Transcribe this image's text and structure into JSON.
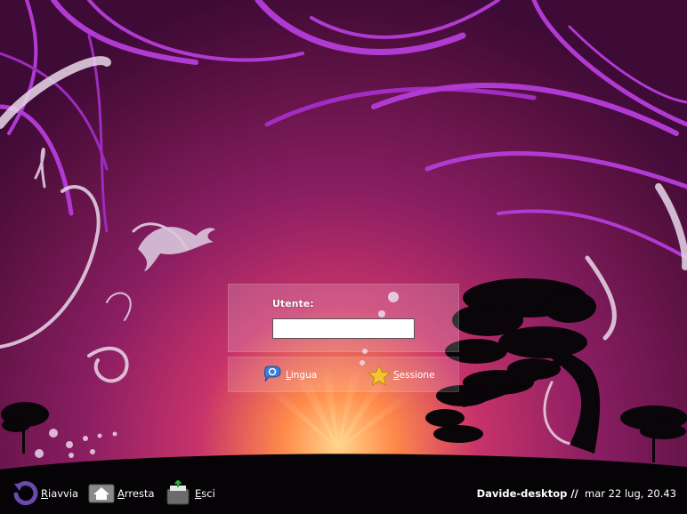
{
  "login": {
    "username_label": "Utente:",
    "username_value": "",
    "language_prefix": "L",
    "language_rest": "ingua",
    "session_prefix": "S",
    "session_rest": "essione"
  },
  "bottom": {
    "restart_prefix": "R",
    "restart_rest": "iavvia",
    "shutdown_prefix": "A",
    "shutdown_rest": "rresta",
    "exit_prefix": "E",
    "exit_rest": "sci",
    "hostname": "Davide-desktop",
    "separator": " //",
    "datetime": "mar 22 lug, 20.43"
  },
  "icons": {
    "language": "speech-bubble-icon",
    "session": "star-icon",
    "restart": "restart-arrow-icon",
    "shutdown": "house-icon",
    "exit": "exit-recycle-icon"
  },
  "colors": {
    "background_top": "#4a0d43",
    "background_glow": "#ff9a4a",
    "accent_purple": "#b03ad0",
    "ground": "#050305"
  }
}
